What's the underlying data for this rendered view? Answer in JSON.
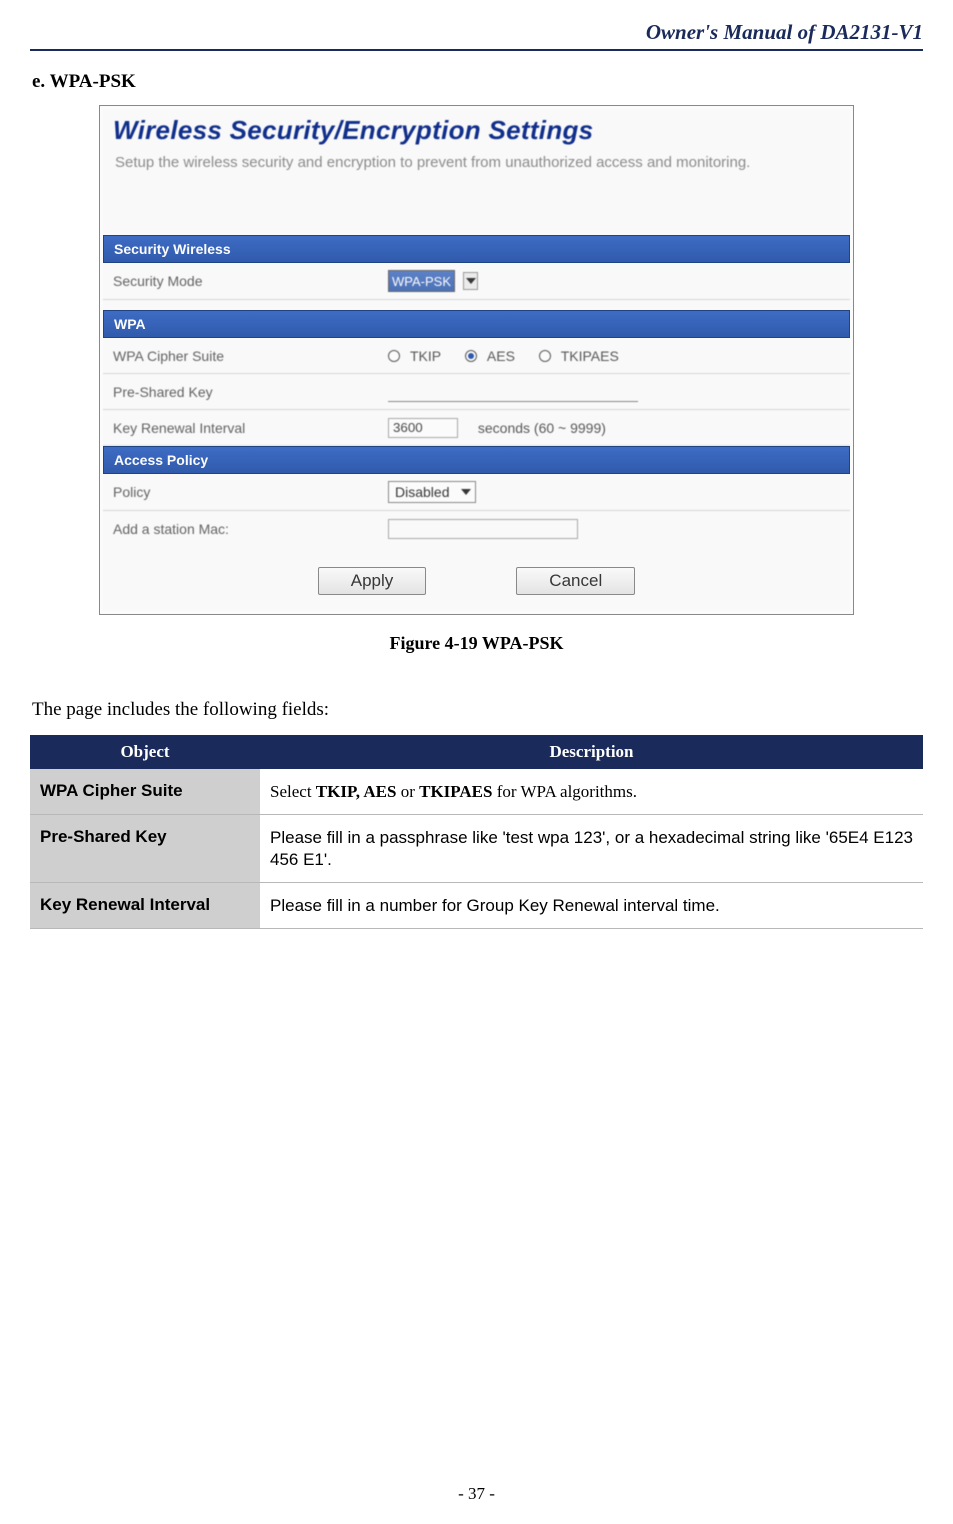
{
  "header": "Owner's Manual of DA2131-V1",
  "section_heading": "e. WPA-PSK",
  "screenshot": {
    "title": "Wireless Security/Encryption Settings",
    "desc": "Setup the wireless security and encryption to prevent from unauthorized access and monitoring.",
    "sec_wireless_header": "Security Wireless",
    "security_mode_label": "Security Mode",
    "security_mode_value": "WPA-PSK",
    "wpa_header": "WPA",
    "cipher_label": "WPA Cipher Suite",
    "cipher_opt1": "TKIP",
    "cipher_opt2": "AES",
    "cipher_opt3": "TKIPAES",
    "psk_label": "Pre-Shared Key",
    "renewal_label": "Key Renewal Interval",
    "renewal_value": "3600",
    "renewal_suffix": "seconds   (60 ~ 9999)",
    "access_header": "Access Policy",
    "policy_label": "Policy",
    "policy_value": "Disabled",
    "mac_label": "Add a station Mac:",
    "btn_apply": "Apply",
    "btn_cancel": "Cancel"
  },
  "caption": "Figure 4-19 WPA-PSK",
  "body_text": "The page includes the following fields:",
  "table": {
    "head_obj": "Object",
    "head_desc": "Description",
    "rows": [
      {
        "obj": "WPA Cipher Suite",
        "desc_pre": "Select ",
        "desc_bold": "TKIP, AES",
        "desc_mid": " or ",
        "desc_bold2": "TKIPAES",
        "desc_post": " for WPA algorithms."
      },
      {
        "obj": "Pre-Shared Key",
        "desc": "Please fill in a passphrase like 'test wpa 123', or a hexadecimal string like '65E4 E123 456 E1'."
      },
      {
        "obj": "Key Renewal Interval",
        "desc": "Please fill in a number for Group Key Renewal interval time."
      }
    ]
  },
  "page_num": "- 37 -"
}
